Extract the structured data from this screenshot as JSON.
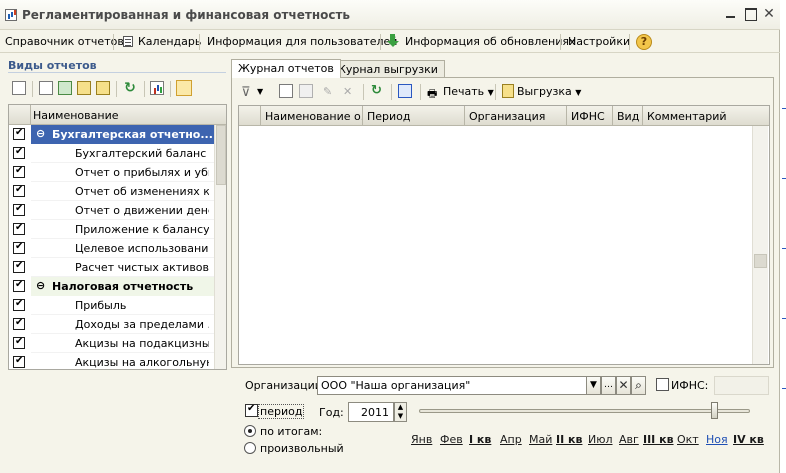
{
  "window": {
    "title": "Регламентированная и финансовая отчетность"
  },
  "menu": {
    "reports_directory": "Справочник отчетов",
    "calendar": "Календарь",
    "user_info": "Информация для пользователей",
    "update_info": "Информация об обновлениях",
    "settings": "Настройки"
  },
  "left": {
    "title": "Виды отчетов",
    "column_header": "Наименование",
    "rows": [
      {
        "label": "Бухгалтерская отчетно...",
        "checked": true
      },
      {
        "label": "Бухгалтерский баланс (...",
        "checked": true
      },
      {
        "label": "Отчет о прибылях и убы...",
        "checked": true
      },
      {
        "label": "Отчет об изменениях ка...",
        "checked": true
      },
      {
        "label": "Отчет о движении дене...",
        "checked": true
      },
      {
        "label": "Приложение к балансу (...",
        "checked": true
      },
      {
        "label": "Целевое использовани...",
        "checked": true
      },
      {
        "label": "Расчет чистых активов",
        "checked": true
      },
      {
        "label": "Налоговая отчетность",
        "checked": true
      },
      {
        "label": "Прибыль",
        "checked": true
      },
      {
        "label": "Доходы за пределами ...",
        "checked": true
      },
      {
        "label": "Акцизы на подакцизны...",
        "checked": true
      },
      {
        "label": "Акцизы на алкогольную...",
        "checked": true
      }
    ]
  },
  "tabs": {
    "journal": "Журнал отчетов",
    "export": "Журнал выгрузки"
  },
  "toolbar": {
    "print": "Печать",
    "export": "Выгрузка"
  },
  "grid": {
    "columns": [
      "Наименование о...",
      "Период",
      "Организация",
      "ИФНС",
      "Вид",
      "Комментарий"
    ]
  },
  "filters": {
    "org_label": "Организации:",
    "org_value": "ООО \"Наша организация\"",
    "ifns_label": "ИФНС:",
    "period_label": "период",
    "period_checked": true,
    "year_label": "Год:",
    "year_value": "2011",
    "mode_totals": "по итогам:",
    "mode_custom": "произвольный",
    "mode_selected": "по итогам:",
    "slider_level": 0.9
  },
  "months": [
    "Янв",
    "Фев",
    "I кв",
    "Апр",
    "Май",
    "II кв",
    "Июл",
    "Авг",
    "III кв",
    "Окт",
    "Ноя",
    "IV кв"
  ]
}
